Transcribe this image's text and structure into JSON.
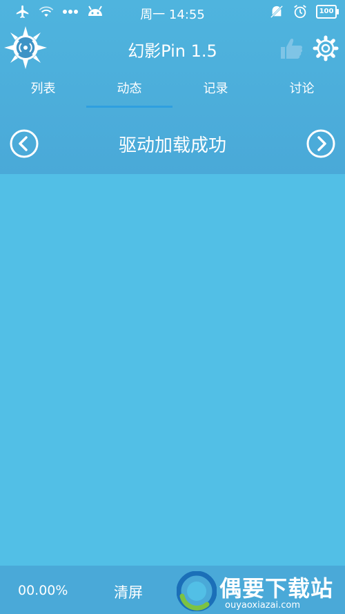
{
  "status_bar": {
    "time": "周一 14:55",
    "battery": "100",
    "icons": [
      "airplane-icon",
      "wifi-icon",
      "more-dots-icon",
      "android-icon",
      "mute-icon",
      "alarm-icon",
      "battery-icon"
    ]
  },
  "app": {
    "title": "幻影Pin 1.5",
    "logo_icon": "signal-compass-icon",
    "like_icon": "thumbs-up-icon",
    "settings_icon": "gear-icon"
  },
  "tabs": [
    {
      "label": "列表",
      "active": false
    },
    {
      "label": "动态",
      "active": true
    },
    {
      "label": "记录",
      "active": false
    },
    {
      "label": "讨论",
      "active": false
    }
  ],
  "status_strip": {
    "message": "驱动加载成功",
    "prev_icon": "chevron-left-circle-icon",
    "next_icon": "chevron-right-circle-icon"
  },
  "bottom_bar": {
    "progress": "00.00%",
    "clear_label": "清屏"
  },
  "watermark": {
    "title": "偶要下载站",
    "url": "ouyaoxiazai.com"
  },
  "colors": {
    "background": "#52bfe6",
    "header": "#4aa9d8",
    "tab_indicator": "#2e9fe0",
    "text": "#ffffff"
  }
}
